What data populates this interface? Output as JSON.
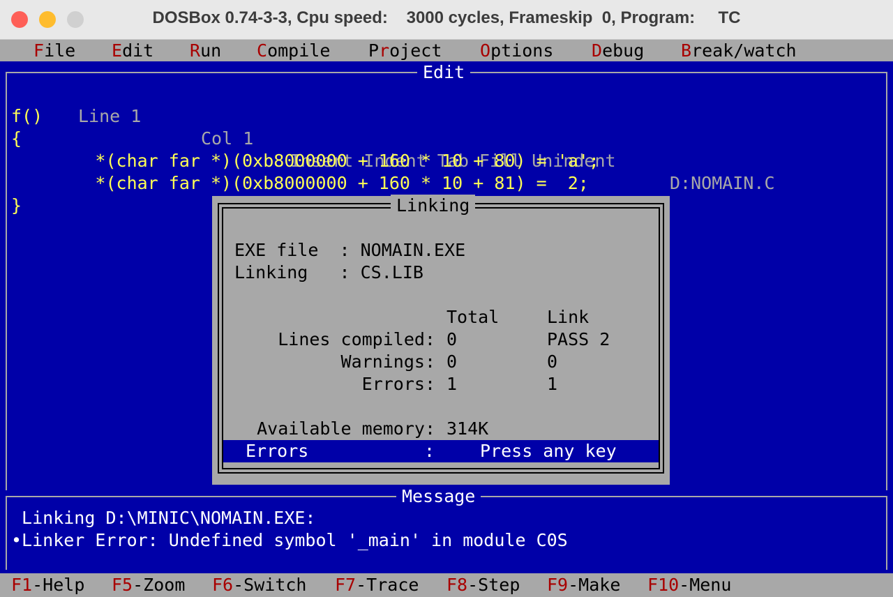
{
  "window": {
    "title": "DOSBox 0.74-3-3, Cpu speed:    3000 cycles, Frameskip  0, Program:     TC"
  },
  "menu": {
    "items": [
      {
        "hot": "F",
        "rest": "ile"
      },
      {
        "hot": "E",
        "rest": "dit"
      },
      {
        "hot": "R",
        "rest": "un"
      },
      {
        "hot": "C",
        "rest": "ompile"
      },
      {
        "pre": "P",
        "hot": "r",
        "rest": "oject"
      },
      {
        "hot": "O",
        "rest": "ptions"
      },
      {
        "hot": "D",
        "rest": "ebug"
      },
      {
        "hot": "B",
        "rest": "reak/watch"
      }
    ]
  },
  "editor": {
    "title": "Edit",
    "status": {
      "line": "Line 1",
      "col": "Col 1",
      "modes": "Insert Indent Tab Fill Unindent",
      "file": "D:NOMAIN.C"
    },
    "code": [
      "f()",
      "{",
      "        *(char far *)(0xb8000000 + 160 * 10 + 80) = 'a';",
      "        *(char far *)(0xb8000000 + 160 * 10 + 81) =  2;",
      "}"
    ]
  },
  "dialog": {
    "title": "Linking",
    "exe_label": "EXE file  : NOMAIN.EXE",
    "linking_label": "Linking   : CS.LIB",
    "col_total": "Total",
    "col_link": "Link",
    "stats": [
      {
        "label": "Lines compiled:",
        "total": "0",
        "link": "PASS 2"
      },
      {
        "label": "Warnings:",
        "total": "0",
        "link": "0"
      },
      {
        "label": "Errors:",
        "total": "1",
        "link": "1"
      }
    ],
    "memory_label": "Available memory:",
    "memory_value": "314K",
    "bar_left": "Errors",
    "bar_colon": ":",
    "bar_right": "Press any key"
  },
  "message": {
    "title": "Message",
    "lines": [
      " Linking D:\\MINIC\\NOMAIN.EXE:",
      "•Linker Error: Undefined symbol '_main' in module C0S"
    ]
  },
  "keys": [
    {
      "key": "F1",
      "label": "-Help"
    },
    {
      "key": "F5",
      "label": "-Zoom"
    },
    {
      "key": "F6",
      "label": "-Switch"
    },
    {
      "key": "F7",
      "label": "-Trace"
    },
    {
      "key": "F8",
      "label": "-Step"
    },
    {
      "key": "F9",
      "label": "-Make"
    },
    {
      "key": "F10",
      "label": "-Menu"
    }
  ],
  "colors": {
    "dos_blue": "#0000a8",
    "dos_gray": "#a8a8a8",
    "dos_yellow": "#ffff55",
    "dos_red": "#a80000"
  }
}
